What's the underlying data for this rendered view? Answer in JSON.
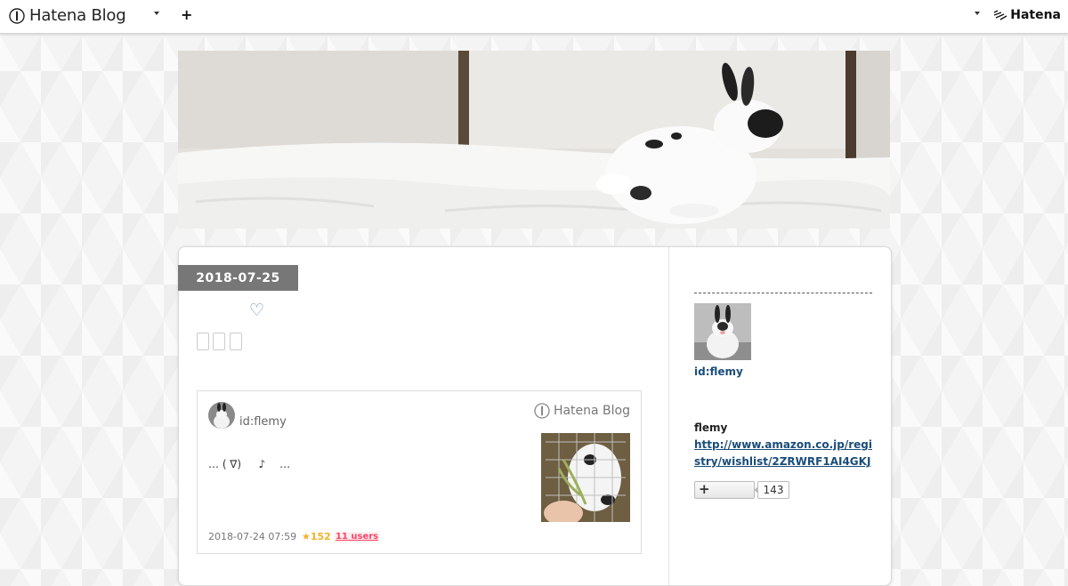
{
  "global_header": {
    "brand": "Hatena Blog",
    "brand_dropdown_icon": "caret-down-icon",
    "add_icon": "plus-icon",
    "account_dropdown_icon": "caret-down-icon",
    "hatena_logo": "Hatena"
  },
  "header_image": {
    "subject": "rabbit-photo"
  },
  "entry": {
    "date": "2018-07-25",
    "heart_icon": "♡",
    "embed": {
      "author": "id:flemy",
      "brand": "Hatena Blog",
      "excerpt": "… ( ∇)　  ♪　 …",
      "date": "2018-07-24 07:59",
      "stars": "★152",
      "bookmark_users": "11 users"
    }
  },
  "sidebar": {
    "profile_id": "id:flemy",
    "profile_name": "flemy",
    "profile_link": "http://www.amazon.co.jp/registry/wishlist/2ZRWRF1AI4GKJ",
    "follow_count": "143"
  },
  "colors": {
    "date_bg": "#777777",
    "link": "#1a4d7a",
    "star": "#f4b128",
    "bookmark": "#ff4166"
  }
}
